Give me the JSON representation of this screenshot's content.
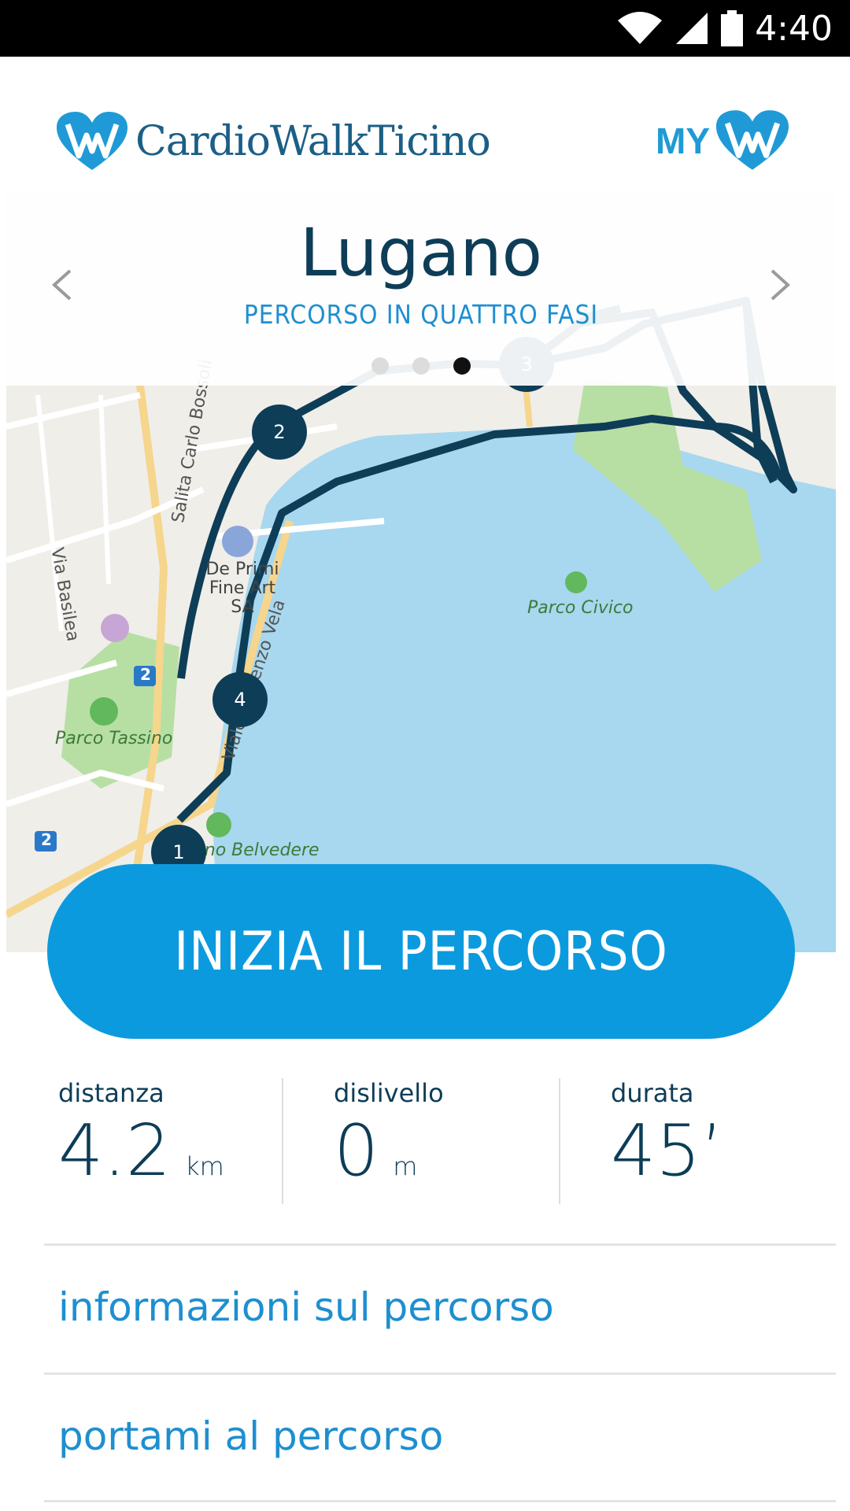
{
  "status_bar": {
    "time": "4:40"
  },
  "header": {
    "logo_text": "CardioWalkTicino",
    "my_label": "MY"
  },
  "route": {
    "city": "Lugano",
    "subtitle": "PERCORSO IN QUATTRO FASI",
    "pager": {
      "total": 3,
      "active": 3
    }
  },
  "map": {
    "street_labels": [
      "Via Basilea",
      "Salita Carlo Bossoli",
      "Viale Vincenzo Vela"
    ],
    "poi_labels": [
      "De Primi Fine Art SA",
      "Parco Tassino",
      "Parco Civico",
      "Giardino Belvedere"
    ],
    "bus_badge": "2",
    "waypoints": [
      "1",
      "2",
      "3",
      "4"
    ]
  },
  "start_button": {
    "label": "INIZIA IL PERCORSO"
  },
  "stats": {
    "distance": {
      "label": "distanza",
      "value": "4.2",
      "unit": "km"
    },
    "elevation": {
      "label": "dislivello",
      "value": "0",
      "unit": "m"
    },
    "duration": {
      "label": "durata",
      "value": "45’"
    }
  },
  "links": {
    "info": "informazioni sul percorso",
    "directions": "portami al percorso"
  },
  "colors": {
    "accent": "#0c9ade",
    "dark_text": "#0d3d57",
    "route_line": "#0e3d57",
    "water": "#a7d8ef",
    "park": "#9fd48a"
  }
}
